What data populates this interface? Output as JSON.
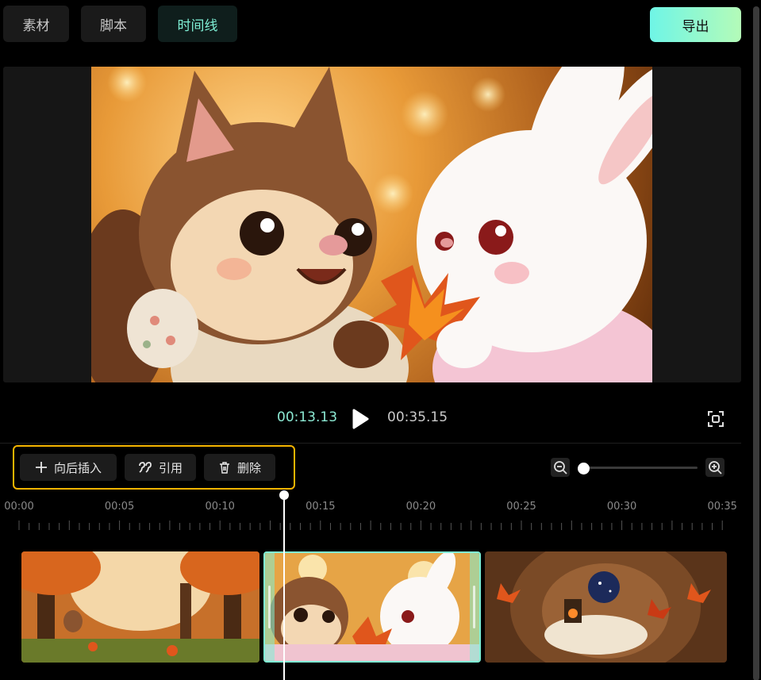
{
  "tabs": [
    {
      "label": "素材",
      "active": false
    },
    {
      "label": "脚本",
      "active": false
    },
    {
      "label": "时间线",
      "active": true
    }
  ],
  "export_label": "导出",
  "player": {
    "current_time": "00:13.13",
    "total_time": "00:35.15"
  },
  "toolbar": {
    "insert_after": "向后插入",
    "quote": "引用",
    "delete": "删除"
  },
  "zoom": {
    "level": 0.05
  },
  "timeline": {
    "ticks": [
      "00:00",
      "00:05",
      "00:10",
      "00:15",
      "00:20",
      "00:25",
      "00:30",
      "00:35"
    ],
    "clips": [
      {
        "scene": "autumn-forest-squirrel",
        "selected": false
      },
      {
        "scene": "squirrel-and-bunny-leaf",
        "selected": true
      },
      {
        "scene": "tree-hollow-interior",
        "selected": false
      }
    ]
  },
  "colors": {
    "accent": "#7ff0d6",
    "highlight_border": "#f5b400",
    "export_gradient_start": "#6ff5e6",
    "export_gradient_end": "#b4fbb8"
  },
  "icons": [
    "plus-icon",
    "quote-icon",
    "trash-icon",
    "zoom-out-icon",
    "zoom-in-icon",
    "play-icon",
    "fullscreen-icon"
  ]
}
